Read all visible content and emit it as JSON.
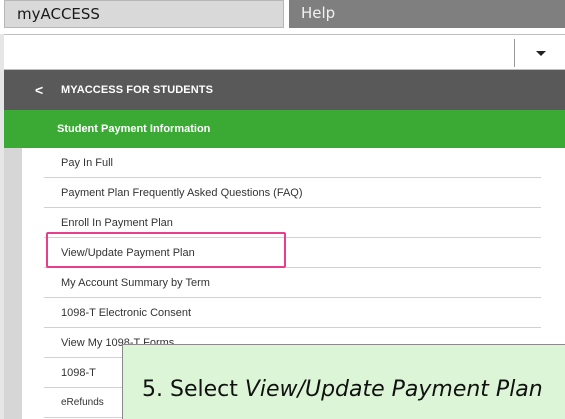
{
  "tabs": {
    "myaccess_label": "myACCESS",
    "help_label": "Help"
  },
  "dropdown": {
    "caret_icon": "caret-down-icon"
  },
  "nav_header": {
    "chevron_icon": "<",
    "title": "MYACCESS FOR STUDENTS"
  },
  "section": {
    "title": "Student Payment Information"
  },
  "menu_items": [
    {
      "label": "Pay In Full"
    },
    {
      "label": "Payment Plan Frequently Asked Questions (FAQ)"
    },
    {
      "label": "Enroll In Payment Plan"
    },
    {
      "label": "View/Update Payment Plan"
    },
    {
      "label": "My Account Summary by Term"
    },
    {
      "label": "1098-T Electronic Consent"
    },
    {
      "label": "View My 1098-T Forms"
    },
    {
      "label": "1098-T"
    },
    {
      "label": "eRefunds"
    }
  ],
  "callout": {
    "prefix": "5. Select ",
    "emphasis": "View/Update Payment Plan"
  },
  "colors": {
    "green": "#3aaa35",
    "header_grey": "#595959",
    "highlight_pink": "#e83e8c",
    "callout_bg": "#dcf5d6"
  }
}
